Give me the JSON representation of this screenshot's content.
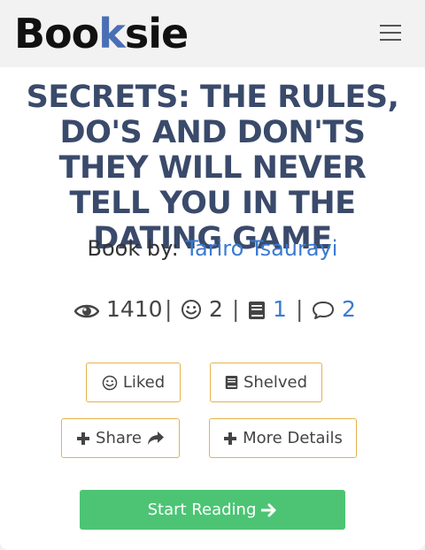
{
  "brand": {
    "logo_prefix": "Boo",
    "logo_k": "k",
    "logo_suffix": "sie"
  },
  "nav": {
    "menu_icon": "hamburger-icon"
  },
  "book": {
    "title": "SECRETS: THE RULES, DO'S AND DON'TS THEY WILL NEVER TELL YOU IN THE DATING GAME",
    "byline_label": "Book by:",
    "author": "Tariro Tsaurayi"
  },
  "stats": {
    "views": "1410",
    "likes": "2",
    "shelves": "1",
    "comments": "2",
    "separator": "|"
  },
  "buttons": {
    "liked": "Liked",
    "shelved": "Shelved",
    "share": "Share",
    "more_details": "More Details",
    "start_reading": "Start Reading"
  },
  "colors": {
    "title": "#3a4a6b",
    "link": "#3b7bd0",
    "button_border": "#e5b24a",
    "start_button": "#4cc474"
  }
}
